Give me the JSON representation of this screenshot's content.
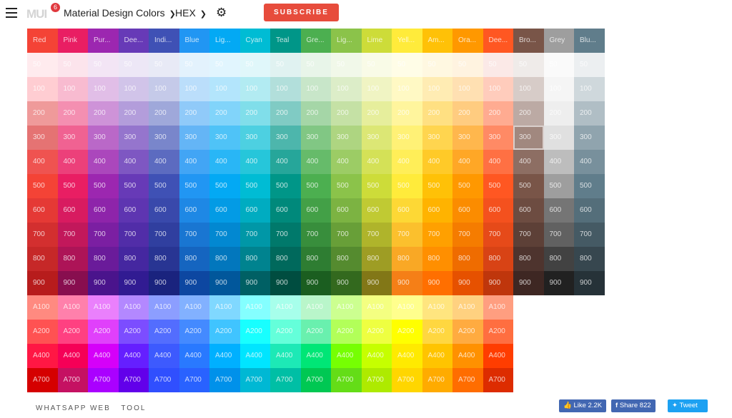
{
  "header": {
    "logo": "MUI",
    "badge": "6",
    "palette_select": "Material Design Colors",
    "format_select": "HEX",
    "subscribe": "SUBSCRIBE"
  },
  "shade_labels": [
    "50",
    "100",
    "200",
    "300",
    "400",
    "500",
    "600",
    "700",
    "800",
    "900"
  ],
  "accent_labels": [
    "A100",
    "A200",
    "A400",
    "A700"
  ],
  "selected": {
    "column": "Brown",
    "shade": "300"
  },
  "columns": [
    {
      "label": "Red",
      "shades": [
        "#FFEBEE",
        "#FFCDD2",
        "#EF9A9A",
        "#E57373",
        "#EF5350",
        "#F44336",
        "#E53935",
        "#D32F2F",
        "#C62828",
        "#B71C1C"
      ],
      "accents": [
        "#FF8A80",
        "#FF5252",
        "#FF1744",
        "#D50000"
      ]
    },
    {
      "label": "Pink",
      "shades": [
        "#FCE4EC",
        "#F8BBD0",
        "#F48FB1",
        "#F06292",
        "#EC407A",
        "#E91E63",
        "#D81B60",
        "#C2185B",
        "#AD1457",
        "#880E4F"
      ],
      "accents": [
        "#FF80AB",
        "#FF4081",
        "#F50057",
        "#C51162"
      ]
    },
    {
      "label": "Pur...",
      "shades": [
        "#F3E5F5",
        "#E1BEE7",
        "#CE93D8",
        "#BA68C8",
        "#AB47BC",
        "#9C27B0",
        "#8E24AA",
        "#7B1FA2",
        "#6A1B9A",
        "#4A148C"
      ],
      "accents": [
        "#EA80FC",
        "#E040FB",
        "#D500F9",
        "#AA00FF"
      ]
    },
    {
      "label": "Dee...",
      "shades": [
        "#EDE7F6",
        "#D1C4E9",
        "#B39DDB",
        "#9575CD",
        "#7E57C2",
        "#673AB7",
        "#5E35B1",
        "#512DA8",
        "#4527A0",
        "#311B92"
      ],
      "accents": [
        "#B388FF",
        "#7C4DFF",
        "#651FFF",
        "#6200EA"
      ]
    },
    {
      "label": "Indi...",
      "shades": [
        "#E8EAF6",
        "#C5CAE9",
        "#9FA8DA",
        "#7986CB",
        "#5C6BC0",
        "#3F51B5",
        "#3949AB",
        "#303F9F",
        "#283593",
        "#1A237E"
      ],
      "accents": [
        "#8C9EFF",
        "#536DFE",
        "#3D5AFE",
        "#304FFE"
      ]
    },
    {
      "label": "Blue",
      "shades": [
        "#E3F2FD",
        "#BBDEFB",
        "#90CAF9",
        "#64B5F6",
        "#42A5F5",
        "#2196F3",
        "#1E88E5",
        "#1976D2",
        "#1565C0",
        "#0D47A1"
      ],
      "accents": [
        "#82B1FF",
        "#448AFF",
        "#2979FF",
        "#2962FF"
      ]
    },
    {
      "label": "Lig...",
      "shades": [
        "#E1F5FE",
        "#B3E5FC",
        "#81D4FA",
        "#4FC3F7",
        "#29B6F6",
        "#03A9F4",
        "#039BE5",
        "#0288D1",
        "#0277BD",
        "#01579B"
      ],
      "accents": [
        "#80D8FF",
        "#40C4FF",
        "#00B0FF",
        "#0091EA"
      ]
    },
    {
      "label": "Cyan",
      "shades": [
        "#E0F7FA",
        "#B2EBF2",
        "#80DEEA",
        "#4DD0E1",
        "#26C6DA",
        "#00BCD4",
        "#00ACC1",
        "#0097A7",
        "#00838F",
        "#006064"
      ],
      "accents": [
        "#84FFFF",
        "#18FFFF",
        "#00E5FF",
        "#00B8D4"
      ]
    },
    {
      "label": "Teal",
      "shades": [
        "#E0F2F1",
        "#B2DFDB",
        "#80CBC4",
        "#4DB6AC",
        "#26A69A",
        "#009688",
        "#00897B",
        "#00796B",
        "#00695C",
        "#004D40"
      ],
      "accents": [
        "#A7FFEB",
        "#64FFDA",
        "#1DE9B6",
        "#00BFA5"
      ]
    },
    {
      "label": "Gre...",
      "shades": [
        "#E8F5E9",
        "#C8E6C9",
        "#A5D6A7",
        "#81C784",
        "#66BB6A",
        "#4CAF50",
        "#43A047",
        "#388E3C",
        "#2E7D32",
        "#1B5E20"
      ],
      "accents": [
        "#B9F6CA",
        "#69F0AE",
        "#00E676",
        "#00C853"
      ]
    },
    {
      "label": "Lig...",
      "shades": [
        "#F1F8E9",
        "#DCEDC8",
        "#C5E1A5",
        "#AED581",
        "#9CCC65",
        "#8BC34A",
        "#7CB342",
        "#689F38",
        "#558B2F",
        "#33691E"
      ],
      "accents": [
        "#CCFF90",
        "#B2FF59",
        "#76FF03",
        "#64DD17"
      ]
    },
    {
      "label": "Lime",
      "shades": [
        "#F9FBE7",
        "#F0F4C3",
        "#E6EE9C",
        "#DCE775",
        "#D4E157",
        "#CDDC39",
        "#C0CA33",
        "#AFB42B",
        "#9E9D24",
        "#827717"
      ],
      "accents": [
        "#F4FF81",
        "#EEFF41",
        "#C6FF00",
        "#AEEA00"
      ]
    },
    {
      "label": "Yell...",
      "shades": [
        "#FFFDE7",
        "#FFF9C4",
        "#FFF59D",
        "#FFF176",
        "#FFEE58",
        "#FFEB3B",
        "#FDD835",
        "#FBC02D",
        "#F9A825",
        "#F57F17"
      ],
      "accents": [
        "#FFFF8D",
        "#FFFF00",
        "#FFEA00",
        "#FFD600"
      ]
    },
    {
      "label": "Am...",
      "shades": [
        "#FFF8E1",
        "#FFECB3",
        "#FFE082",
        "#FFD54F",
        "#FFCA28",
        "#FFC107",
        "#FFB300",
        "#FFA000",
        "#FF8F00",
        "#FF6F00"
      ],
      "accents": [
        "#FFE57F",
        "#FFD740",
        "#FFC400",
        "#FFAB00"
      ]
    },
    {
      "label": "Ora...",
      "shades": [
        "#FFF3E0",
        "#FFE0B2",
        "#FFCC80",
        "#FFB74D",
        "#FFA726",
        "#FF9800",
        "#FB8C00",
        "#F57C00",
        "#EF6C00",
        "#E65100"
      ],
      "accents": [
        "#FFD180",
        "#FFAB40",
        "#FF9100",
        "#FF6D00"
      ]
    },
    {
      "label": "Dee...",
      "shades": [
        "#FBE9E7",
        "#FFCCBC",
        "#FFAB91",
        "#FF8A65",
        "#FF7043",
        "#FF5722",
        "#F4511E",
        "#E64A19",
        "#D84315",
        "#BF360C"
      ],
      "accents": [
        "#FF9E80",
        "#FF6E40",
        "#FF3D00",
        "#DD2C00"
      ]
    },
    {
      "label": "Bro...",
      "shades": [
        "#EFEBE9",
        "#D7CCC8",
        "#BCAAA4",
        "#A1887F",
        "#8D6E63",
        "#795548",
        "#6D4C41",
        "#5D4037",
        "#4E342E",
        "#3E2723"
      ],
      "accents": []
    },
    {
      "label": "Grey",
      "shades": [
        "#FAFAFA",
        "#F5F5F5",
        "#EEEEEE",
        "#E0E0E0",
        "#BDBDBD",
        "#9E9E9E",
        "#757575",
        "#616161",
        "#424242",
        "#212121"
      ],
      "accents": []
    },
    {
      "label": "Blu...",
      "shades": [
        "#ECEFF1",
        "#CFD8DC",
        "#B0BEC5",
        "#90A4AE",
        "#78909C",
        "#607D8B",
        "#546E7A",
        "#455A64",
        "#37474F",
        "#263238"
      ],
      "accents": []
    }
  ],
  "footer": {
    "links": [
      "WHATSAPP WEB",
      "TOOL"
    ],
    "like": "Like 2.2K",
    "share": "Share 822",
    "tweet": "Tweet"
  },
  "colors": {
    "subscribe": "#e74c3c",
    "facebook": "#4267b2",
    "twitter": "#1da1f2"
  }
}
